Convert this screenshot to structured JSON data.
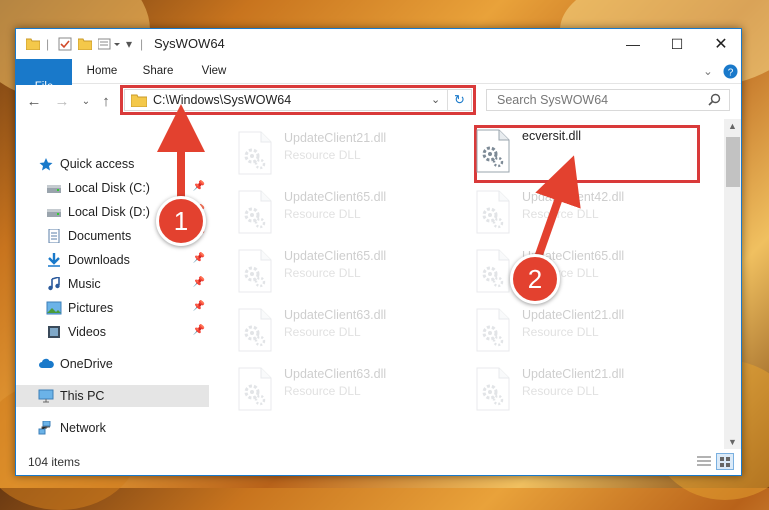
{
  "window": {
    "title": "SysWOW64"
  },
  "ribbon": {
    "tabs": [
      "File",
      "Home",
      "Share",
      "View"
    ]
  },
  "address": {
    "path": "C:\\Windows\\SysWOW64"
  },
  "search": {
    "placeholder": "Search SysWOW64"
  },
  "sidebar": {
    "items": [
      {
        "label": "Quick access",
        "icon": "star-icon"
      },
      {
        "label": "Local Disk (C:)",
        "icon": "drive-icon",
        "pinned": true
      },
      {
        "label": "Local Disk (D:)",
        "icon": "drive-icon",
        "pinned": true
      },
      {
        "label": "Documents",
        "icon": "documents-icon",
        "pinned": true
      },
      {
        "label": "Downloads",
        "icon": "download-icon",
        "pinned": true
      },
      {
        "label": "Music",
        "icon": "music-icon",
        "pinned": true
      },
      {
        "label": "Pictures",
        "icon": "pictures-icon",
        "pinned": true
      },
      {
        "label": "Videos",
        "icon": "videos-icon",
        "pinned": true
      },
      {
        "label": "OneDrive",
        "icon": "cloud-icon"
      },
      {
        "label": "This PC",
        "icon": "computer-icon",
        "selected": true
      },
      {
        "label": "Network",
        "icon": "network-icon"
      }
    ]
  },
  "files": [
    {
      "name": "UpdateClient21.dll",
      "type": "Resource DLL"
    },
    {
      "name": "ecversit.dll",
      "type": ""
    },
    {
      "name": "UpdateClient65.dll",
      "type": "Resource DLL"
    },
    {
      "name": "UpdateClient42.dll",
      "type": "Resource DLL"
    },
    {
      "name": "UpdateClient65.dll",
      "type": "Resource DLL"
    },
    {
      "name": "UpdateClient65.dll",
      "type": "Resource DLL"
    },
    {
      "name": "UpdateClient63.dll",
      "type": "Resource DLL"
    },
    {
      "name": "UpdateClient21.dll",
      "type": "Resource DLL"
    },
    {
      "name": "UpdateClient63.dll",
      "type": "Resource DLL"
    },
    {
      "name": "UpdateClient21.dll",
      "type": "Resource DLL"
    }
  ],
  "status": {
    "count": "104 items"
  },
  "annotations": {
    "step1": "1",
    "step2": "2"
  },
  "colors": {
    "accent": "#1979ca",
    "highlight": "#d93a3a"
  }
}
